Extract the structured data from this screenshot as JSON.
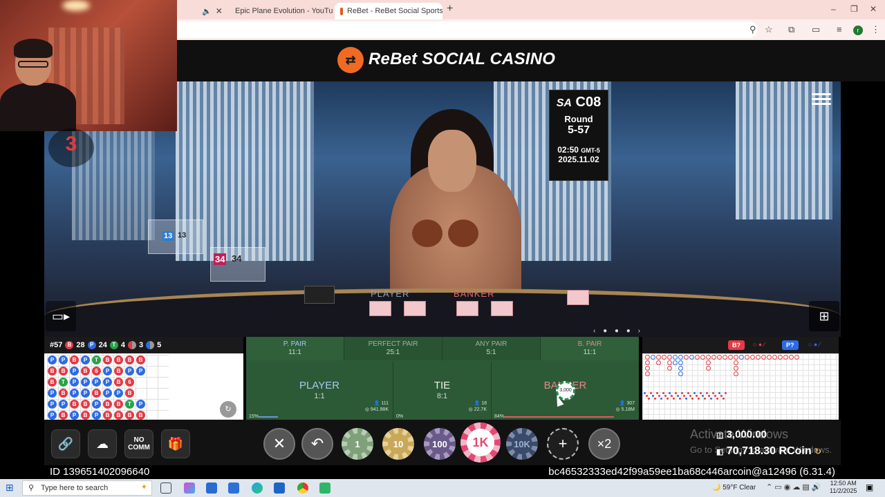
{
  "browser": {
    "tabs": [
      {
        "label": "",
        "icon": "speaker-icon"
      },
      {
        "label": "Epic Plane Evolution - YouTube",
        "icon": "youtube-icon"
      },
      {
        "label": "ReBet - ReBet Social Sportsb",
        "icon": "rebet-icon",
        "active": true
      }
    ],
    "new_tab": "+",
    "win_min": "–",
    "win_max": "❐",
    "win_close": "✕",
    "profile_initial": "r"
  },
  "site": {
    "logo_symbol": "⇄",
    "title": "ReBet SOCIAL CASINO",
    "brand_color": "#f06a24"
  },
  "video": {
    "countdown": "3",
    "table_code": "C08",
    "table_brand": "SA",
    "round_label": "Round",
    "round_number": "5-57",
    "time": "02:50",
    "timezone": "GMT-5",
    "date": "2025.11.02",
    "felt_player": "PLAYER",
    "felt_banker": "BANKER",
    "shoe_left_count_a": "13",
    "shoe_left_count_b": "13",
    "shoe_right_count_a": "34",
    "shoe_right_count_b": "34",
    "carousel": "‹ ● ● ● ›"
  },
  "road_left": {
    "shoe_number": "#57",
    "banker_label": "B",
    "banker_count": "28",
    "player_label": "P",
    "player_count": "24",
    "tie_label": "T",
    "tie_count": "4",
    "bpair_count": "3",
    "ppair_count": "5",
    "beads": [
      [
        "P",
        "P",
        "B",
        "P",
        "T",
        "B",
        "B",
        "B",
        "B"
      ],
      [
        "B",
        "B",
        "P",
        "B",
        "6",
        "P",
        "B",
        "P",
        "P"
      ],
      [
        "B",
        "T",
        "P",
        "P",
        "P",
        "P",
        "B",
        "6"
      ],
      [
        "P",
        "B",
        "P",
        "P",
        "B",
        "P",
        "P",
        "B"
      ],
      [
        "P",
        "P",
        "B",
        "B",
        "P",
        "B",
        "B",
        "T",
        "P"
      ],
      [
        "P",
        "B",
        "P",
        "B",
        "P",
        "B",
        "B",
        "B",
        "B"
      ],
      [
        "P",
        "B",
        "P",
        "T",
        "B",
        "P",
        "B",
        "P"
      ]
    ],
    "scroll_btn": "↻"
  },
  "bets": {
    "side": [
      {
        "name": "P. PAIR",
        "odds": "11:1"
      },
      {
        "name": "PERFECT PAIR",
        "odds": "25:1"
      },
      {
        "name": "ANY PAIR",
        "odds": "5:1"
      },
      {
        "name": "B. PAIR",
        "odds": "11:1"
      }
    ],
    "main": [
      {
        "name": "PLAYER",
        "odds": "1:1",
        "players": "111",
        "amount": "941.98K",
        "pct": "15%",
        "pct_value": 15,
        "color": "#a9c8ef"
      },
      {
        "name": "TIE",
        "odds": "8:1",
        "players": "18",
        "amount": "22.7K",
        "pct": "0%",
        "pct_value": 0,
        "color": "#d7ead7"
      },
      {
        "name": "BANKER",
        "odds": "",
        "players": "307",
        "amount": "5.18M",
        "pct": "84%",
        "pct_value": 84,
        "color": "#e8868b"
      }
    ],
    "placed_chip": "3,000"
  },
  "road_right": {
    "ask_banker": "B?",
    "ask_player": "P?"
  },
  "controls": {
    "link_icon": "🔗",
    "history_icon": "☁",
    "no_comm_line1": "NO",
    "no_comm_line2": "COMM",
    "gift_icon": "🎁",
    "cancel": "✕",
    "undo": "↶",
    "chips": [
      {
        "label": "1",
        "color": "#7fa07a"
      },
      {
        "label": "10",
        "color": "#c9a85a"
      },
      {
        "label": "100",
        "color": "#6a5a8a"
      },
      {
        "label": "1K",
        "color": "#e24a73"
      },
      {
        "label": "10K",
        "color": "#3a4a6a"
      }
    ],
    "add": "+",
    "double": "×2",
    "bet_total": "3,000.00",
    "balance": "70,718.30 RCoin",
    "watermark_1": "Activate Windows",
    "watermark_2": "Go to Settings to activate Windows."
  },
  "id_bar": {
    "left": "ID 139651402096640",
    "right": "bc46532333ed42f99a59ee1ba68c446arcoin@a12496 (6.31.4)"
  },
  "taskbar": {
    "search_placeholder": "Type here to search",
    "temp": "59°F",
    "weather": "Clear",
    "time": "12:50 AM",
    "date": "11/2/2025"
  }
}
